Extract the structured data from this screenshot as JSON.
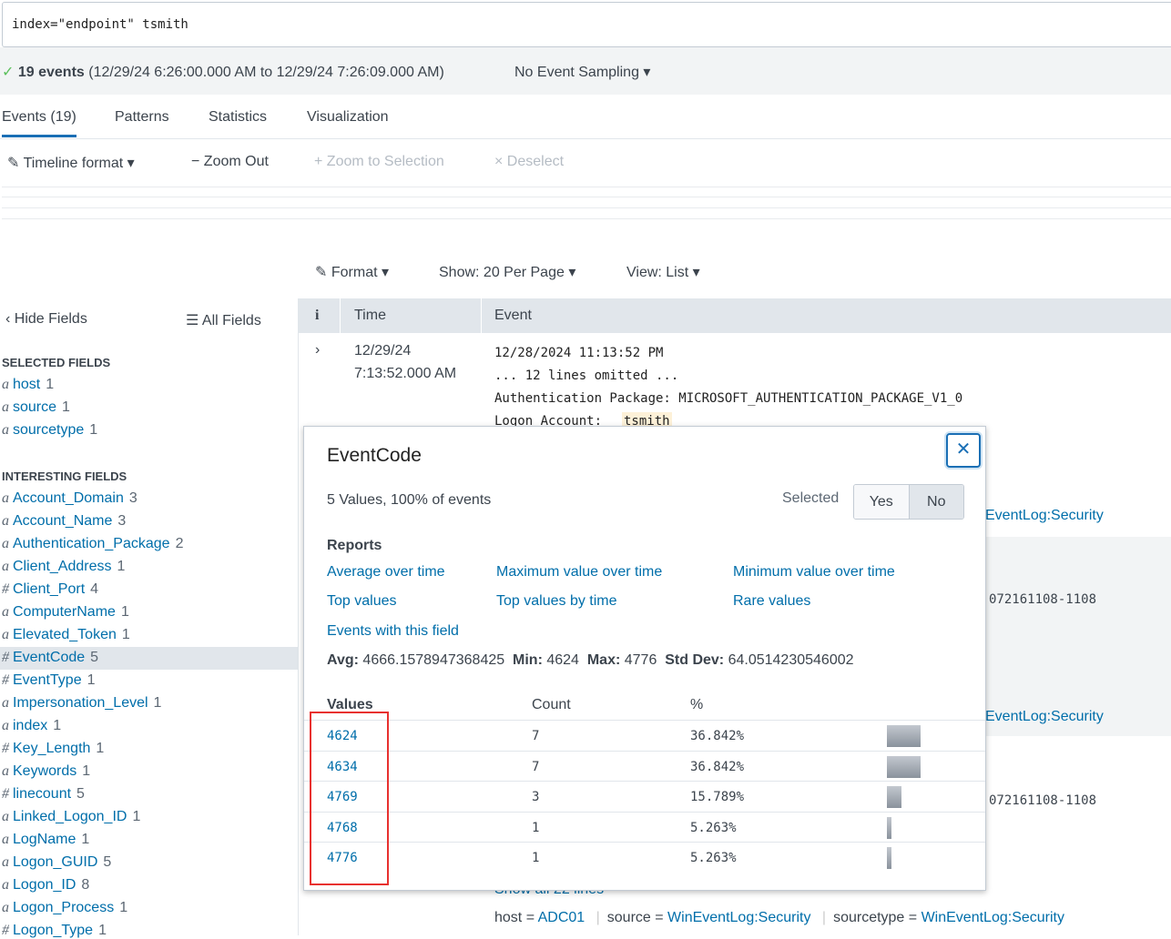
{
  "search": {
    "query": "index=\"endpoint\" tsmith"
  },
  "status": {
    "count": "19 events",
    "range": "(12/29/24 6:26:00.000 AM to 12/29/24 7:26:09.000 AM)",
    "sampling": "No Event Sampling"
  },
  "tabs": [
    "Events (19)",
    "Patterns",
    "Statistics",
    "Visualization"
  ],
  "timeline": {
    "format": "Timeline format",
    "zoom_out": "Zoom Out",
    "zoom_sel": "Zoom to Selection",
    "deselect": "Deselect"
  },
  "results_toolbar": {
    "format": "Format",
    "show": "Show: 20 Per Page",
    "view": "View: List"
  },
  "sidebar": {
    "hide": "Hide Fields",
    "all": "All Fields",
    "selected_title": "SELECTED FIELDS",
    "interesting_title": "INTERESTING FIELDS",
    "selected": [
      {
        "type": "a",
        "name": "host",
        "count": "1"
      },
      {
        "type": "a",
        "name": "source",
        "count": "1"
      },
      {
        "type": "a",
        "name": "sourcetype",
        "count": "1"
      }
    ],
    "interesting": [
      {
        "type": "a",
        "name": "Account_Domain",
        "count": "3"
      },
      {
        "type": "a",
        "name": "Account_Name",
        "count": "3"
      },
      {
        "type": "a",
        "name": "Authentication_Package",
        "count": "2"
      },
      {
        "type": "a",
        "name": "Client_Address",
        "count": "1"
      },
      {
        "type": "#",
        "name": "Client_Port",
        "count": "4"
      },
      {
        "type": "a",
        "name": "ComputerName",
        "count": "1"
      },
      {
        "type": "a",
        "name": "Elevated_Token",
        "count": "1"
      },
      {
        "type": "#",
        "name": "EventCode",
        "count": "5"
      },
      {
        "type": "#",
        "name": "EventType",
        "count": "1"
      },
      {
        "type": "a",
        "name": "Impersonation_Level",
        "count": "1"
      },
      {
        "type": "a",
        "name": "index",
        "count": "1"
      },
      {
        "type": "#",
        "name": "Key_Length",
        "count": "1"
      },
      {
        "type": "a",
        "name": "Keywords",
        "count": "1"
      },
      {
        "type": "#",
        "name": "linecount",
        "count": "5"
      },
      {
        "type": "a",
        "name": "Linked_Logon_ID",
        "count": "1"
      },
      {
        "type": "a",
        "name": "LogName",
        "count": "1"
      },
      {
        "type": "a",
        "name": "Logon_GUID",
        "count": "5"
      },
      {
        "type": "a",
        "name": "Logon_ID",
        "count": "8"
      },
      {
        "type": "a",
        "name": "Logon_Process",
        "count": "1"
      },
      {
        "type": "#",
        "name": "Logon_Type",
        "count": "1"
      }
    ]
  },
  "table": {
    "info": "i",
    "time": "Time",
    "event": "Event"
  },
  "event1": {
    "date": "12/29/24",
    "time": "7:13:52.000 AM",
    "lines": [
      "12/28/2024 11:13:52 PM",
      "... 12 lines omitted ...",
      "Authentication Package: MICROSOFT_AUTHENTICATION_PACKAGE_V1_0"
    ],
    "logon_label": "Logon Account:",
    "logon_value": "tsmith"
  },
  "background": {
    "src1": "EventLog:Security",
    "id1": "072161108-1108",
    "src2": "EventLog:Security",
    "id2": "072161108-1108",
    "show_all": "Show all 22 lines",
    "host_label": "host =",
    "host": "ADC01",
    "source_label": "source =",
    "source": "WinEventLog:Security",
    "sourcetype_label": "sourcetype =",
    "sourcetype": "WinEventLog:Security"
  },
  "popup": {
    "title": "EventCode",
    "summary": "5 Values, 100% of events",
    "selected_label": "Selected",
    "yes": "Yes",
    "no": "No",
    "selected_value": "No",
    "reports_title": "Reports",
    "reports": [
      "Average over time",
      "Maximum value over time",
      "Minimum value over time",
      "Top values",
      "Top values by time",
      "Rare values",
      "Events with this field"
    ],
    "stats": {
      "avg_l": "Avg:",
      "avg": "4666.1578947368425",
      "min_l": "Min:",
      "min": "4624",
      "max_l": "Max:",
      "max": "4776",
      "std_l": "Std Dev:",
      "std": "64.0514230546002"
    },
    "columns": [
      "Values",
      "Count",
      "%"
    ],
    "values": [
      {
        "value": "4624",
        "count": "7",
        "pct": "36.842%",
        "frac": 0.36842
      },
      {
        "value": "4634",
        "count": "7",
        "pct": "36.842%",
        "frac": 0.36842
      },
      {
        "value": "4769",
        "count": "3",
        "pct": "15.789%",
        "frac": 0.15789
      },
      {
        "value": "4768",
        "count": "1",
        "pct": "5.263%",
        "frac": 0.05263
      },
      {
        "value": "4776",
        "count": "1",
        "pct": "5.263%",
        "frac": 0.05263
      }
    ]
  },
  "colors": {
    "link": "#006eaa",
    "highlight": "#e8312f",
    "tab_active": "#1a6fb5"
  }
}
